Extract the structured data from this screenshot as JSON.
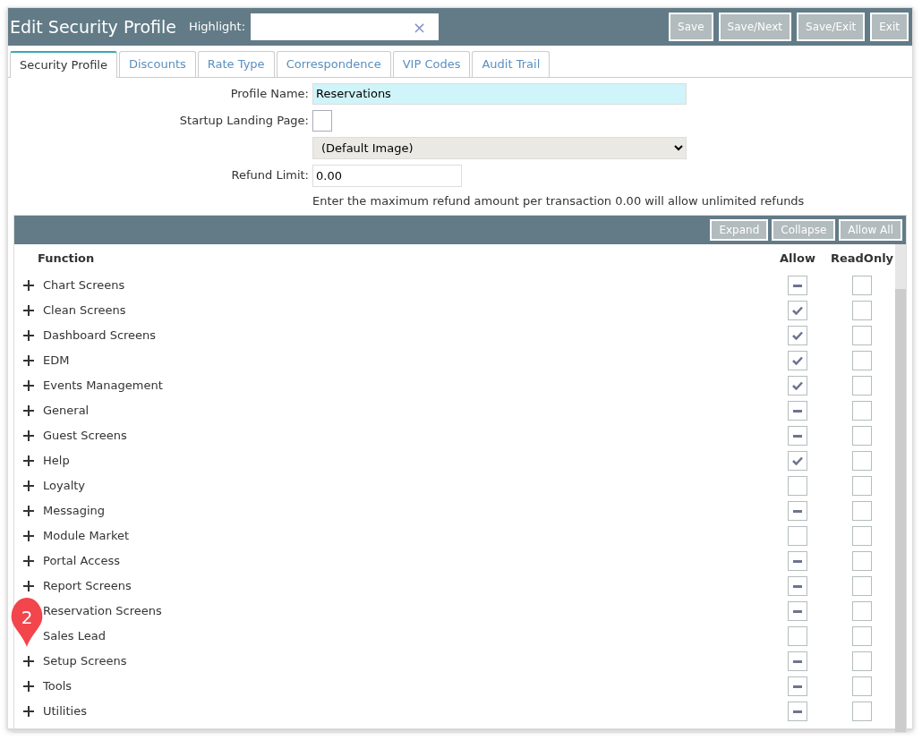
{
  "header": {
    "title": "Edit Security Profile",
    "highlight_label": "Highlight:",
    "clear_symbol": "×",
    "buttons": [
      "Save",
      "Save/Next",
      "Save/Exit",
      "Exit"
    ]
  },
  "tabs": [
    {
      "label": "Security Profile",
      "selected": true
    },
    {
      "label": "Discounts",
      "selected": false
    },
    {
      "label": "Rate Type",
      "selected": false
    },
    {
      "label": "Correspondence",
      "selected": false
    },
    {
      "label": "VIP Codes",
      "selected": false
    },
    {
      "label": "Audit Trail",
      "selected": false
    }
  ],
  "form": {
    "profile_name_label": "Profile Name:",
    "profile_name": "Reservations",
    "landing_label": "Startup Landing Page:",
    "landing_checked": false,
    "image_select": "(Default Image)",
    "refund_label": "Refund Limit:",
    "refund_value": "0.00",
    "refund_hint": "Enter the maximum refund amount per transaction 0.00 will allow unlimited refunds"
  },
  "toolbar": {
    "buttons": [
      "Expand",
      "Collapse",
      "Allow All"
    ]
  },
  "columns": [
    "Function",
    "Allow",
    "ReadOnly"
  ],
  "rows": [
    {
      "name": "Chart Screens",
      "allow_checked": false,
      "allow_indeterminate": true,
      "readonly": false
    },
    {
      "name": "Clean Screens",
      "allow_checked": true,
      "allow_indeterminate": false,
      "readonly": false
    },
    {
      "name": "Dashboard Screens",
      "allow_checked": true,
      "allow_indeterminate": false,
      "readonly": false
    },
    {
      "name": "EDM",
      "allow_checked": true,
      "allow_indeterminate": false,
      "readonly": false
    },
    {
      "name": "Events Management",
      "allow_checked": true,
      "allow_indeterminate": false,
      "readonly": false
    },
    {
      "name": "General",
      "allow_checked": false,
      "allow_indeterminate": true,
      "readonly": false
    },
    {
      "name": "Guest Screens",
      "allow_checked": false,
      "allow_indeterminate": true,
      "readonly": false
    },
    {
      "name": "Help",
      "allow_checked": true,
      "allow_indeterminate": false,
      "readonly": false
    },
    {
      "name": "Loyalty",
      "allow_checked": false,
      "allow_indeterminate": false,
      "readonly": false
    },
    {
      "name": "Messaging",
      "allow_checked": false,
      "allow_indeterminate": true,
      "readonly": false
    },
    {
      "name": "Module Market",
      "allow_checked": false,
      "allow_indeterminate": false,
      "readonly": false
    },
    {
      "name": "Portal Access",
      "allow_checked": false,
      "allow_indeterminate": true,
      "readonly": false
    },
    {
      "name": "Report Screens",
      "allow_checked": false,
      "allow_indeterminate": true,
      "readonly": false
    },
    {
      "name": "Reservation Screens",
      "allow_checked": false,
      "allow_indeterminate": true,
      "readonly": false
    },
    {
      "name": "Sales Lead",
      "allow_checked": false,
      "allow_indeterminate": false,
      "readonly": false
    },
    {
      "name": "Setup Screens",
      "allow_checked": false,
      "allow_indeterminate": true,
      "readonly": false
    },
    {
      "name": "Tools",
      "allow_checked": false,
      "allow_indeterminate": true,
      "readonly": false
    },
    {
      "name": "Utilities",
      "allow_checked": false,
      "allow_indeterminate": true,
      "readonly": false
    }
  ],
  "callout": {
    "label": "2"
  }
}
